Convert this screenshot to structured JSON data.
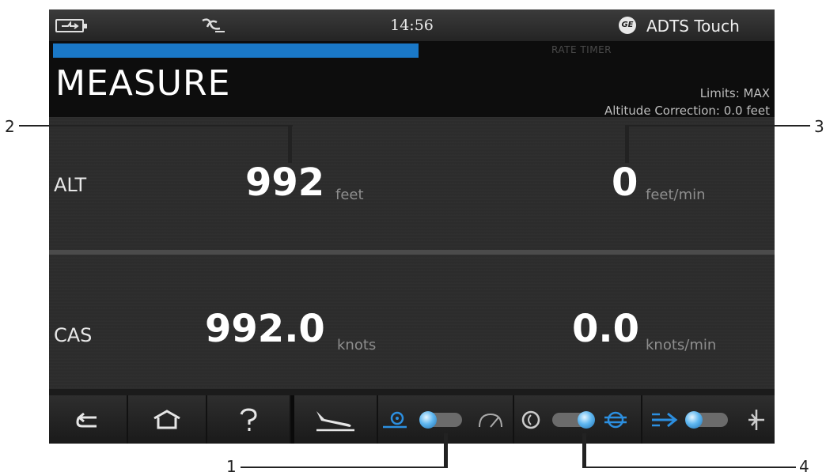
{
  "status": {
    "time": "14:56",
    "brand_logo": "GE",
    "product": "ADTS Touch",
    "icons": [
      "battery-charging-icon",
      "network-disconnected-icon",
      "ge-logo"
    ]
  },
  "header": {
    "progress_fraction": 0.5,
    "rate_timer": "RATE TIMER",
    "title": "MEASURE",
    "limits": "Limits: MAX",
    "altitude_correction": "Altitude Correction: 0.0 feet"
  },
  "rows": [
    {
      "label": "ALT",
      "value": "992",
      "unit": "feet",
      "rate_value": "0",
      "rate_unit": "feet/min"
    },
    {
      "label": "CAS",
      "value": "992.0",
      "unit": "knots",
      "rate_value": "0.0",
      "rate_unit": "knots/min"
    }
  ],
  "bottom_bar": {
    "buttons": [
      "back-icon",
      "home-icon",
      "help-icon",
      "aircraft-landing-icon"
    ],
    "toggles": [
      {
        "name": "ground-to-measure-toggle",
        "left_icon": "target-icon",
        "right_icon": "gauge-icon",
        "state": "left"
      },
      {
        "name": "pitot-static-toggle",
        "left_icon": "dial-icon",
        "right_icon": "static-icon",
        "state": "right"
      },
      {
        "name": "mode-toggle",
        "left_icon": "arrow-right-icon",
        "right_icon": "aircraft-icon",
        "state": "left"
      }
    ],
    "accent_color": "#1a78c7"
  },
  "callouts": [
    "1",
    "2",
    "3",
    "4"
  ]
}
